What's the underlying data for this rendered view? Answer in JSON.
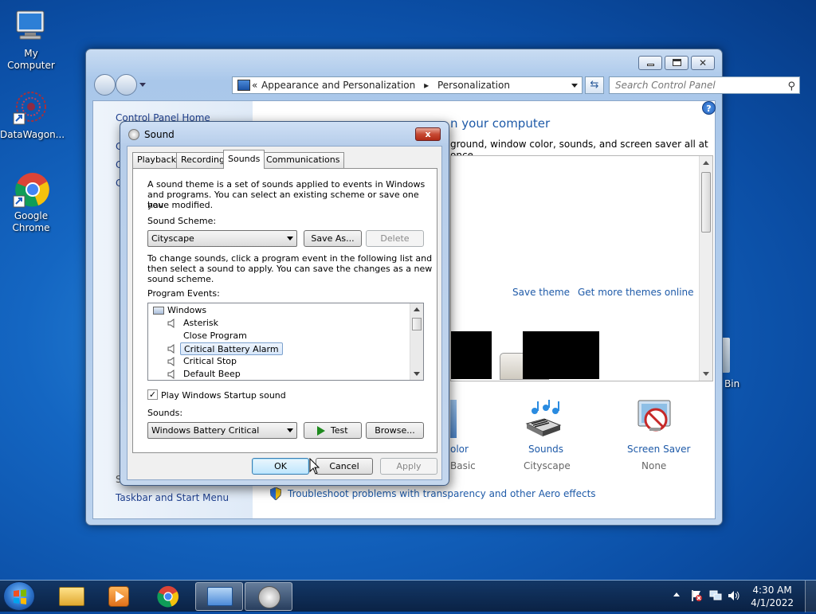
{
  "desktop": {
    "icons": [
      {
        "label": "My Computer"
      },
      {
        "label": "DataWagon..."
      },
      {
        "label": "Google Chrome"
      },
      {
        "label": "Bin"
      }
    ]
  },
  "control_panel": {
    "address": {
      "sep1": "«",
      "crumb1": "Appearance and Personalization",
      "crumb2": "Personalization"
    },
    "search_placeholder": "Search Control Panel",
    "left": {
      "home": "Control Panel Home",
      "partial_c1": "C",
      "partial_c2": "C",
      "partial_c3": "C",
      "see_also_partial": "S",
      "taskbar_link": "Taskbar and Start Menu"
    },
    "main": {
      "heading_partial": "n your computer",
      "desc_partial": "ground, window color, sounds, and screen saver all at once.",
      "save_theme": "Save theme",
      "more_themes": "Get more themes online",
      "color_partial": "olor",
      "basic_partial": "Basic",
      "sounds_label": "Sounds",
      "sounds_value": "Cityscape",
      "screensaver_label": "Screen Saver",
      "screensaver_value": "None",
      "troubleshoot": "Troubleshoot problems with transparency and other Aero effects"
    }
  },
  "sound_dialog": {
    "title": "Sound",
    "close": "x",
    "tabs": [
      "Playback",
      "Recording",
      "Sounds",
      "Communications"
    ],
    "intro": [
      "A sound theme is a set of sounds applied to events in Windows",
      "and programs.  You can select an existing scheme or save one you",
      "have modified."
    ],
    "scheme_label": "Sound Scheme:",
    "scheme_value": "Cityscape",
    "save_as": "Save As...",
    "delete": "Delete",
    "instructions": [
      "To change sounds, click a program event in the following list and",
      "then select a sound to apply.  You can save the changes as a new",
      "sound scheme."
    ],
    "events_label": "Program Events:",
    "events": {
      "group": "Windows",
      "items": [
        "Asterisk",
        "Close Program",
        "Critical Battery Alarm",
        "Critical Stop",
        "Default Beep"
      ]
    },
    "startup_label": "Play Windows Startup sound",
    "startup_checked": "✓",
    "sounds_label": "Sounds:",
    "sounds_value": "Windows Battery Critical",
    "test": "Test",
    "browse": "Browse...",
    "ok": "OK",
    "cancel": "Cancel",
    "apply": "Apply"
  },
  "taskbar": {
    "time": "4:30 AM",
    "date": "4/1/2022"
  }
}
